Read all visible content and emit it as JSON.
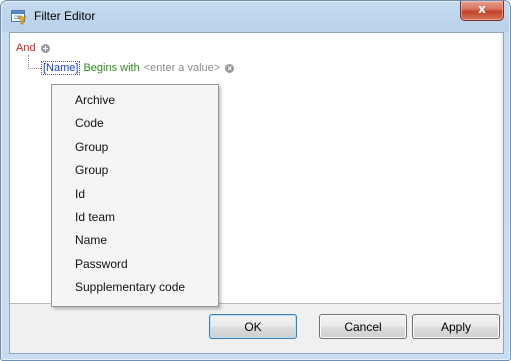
{
  "window": {
    "title": "Filter Editor",
    "close_glyph": "x"
  },
  "editor": {
    "group_operator": "And",
    "condition": {
      "field": "[Name]",
      "operator": "Begins with",
      "value_placeholder": "<enter a value>"
    }
  },
  "dropdown": {
    "items": [
      "Archive",
      "Code",
      "Group",
      "Group",
      "Id",
      "Id team",
      "Name",
      "Password",
      "Supplementary code"
    ]
  },
  "buttons": {
    "ok": "OK",
    "cancel": "Cancel",
    "apply": "Apply"
  },
  "colors": {
    "group_operator": "#d21f1f",
    "field": "#1a3fc6",
    "operator": "#2e8b20",
    "placeholder": "#8c8c8c"
  },
  "icons": {
    "title": "filter-editor-icon",
    "add_condition": "plus-circle-icon",
    "remove_condition": "x-circle-icon"
  }
}
